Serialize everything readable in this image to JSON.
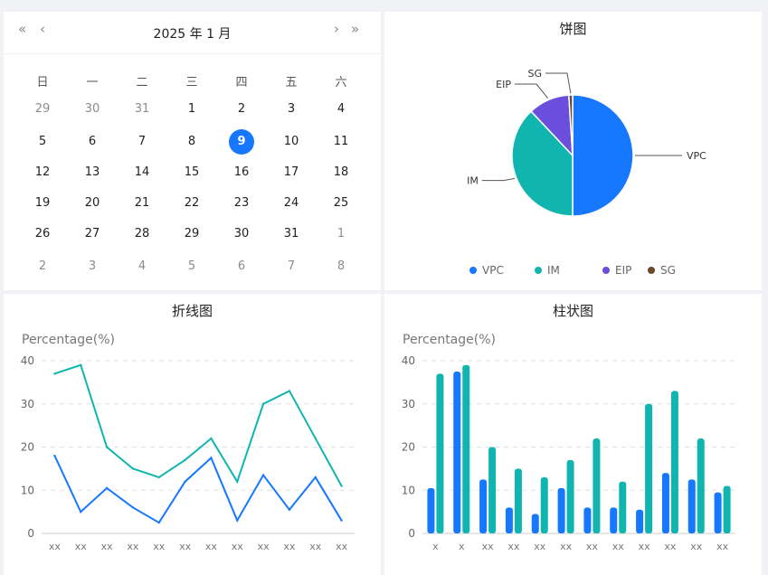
{
  "calendar": {
    "title": "2025 年  1 月",
    "nav": {
      "prev_year": "«",
      "prev_month": "‹",
      "next_month": "›",
      "next_year": "»"
    },
    "weekdays": [
      "日",
      "一",
      "二",
      "三",
      "四",
      "五",
      "六"
    ],
    "weeks": [
      [
        {
          "d": "29",
          "o": true
        },
        {
          "d": "30",
          "o": true
        },
        {
          "d": "31",
          "o": true
        },
        {
          "d": "1"
        },
        {
          "d": "2"
        },
        {
          "d": "3"
        },
        {
          "d": "4"
        }
      ],
      [
        {
          "d": "5"
        },
        {
          "d": "6"
        },
        {
          "d": "7"
        },
        {
          "d": "8"
        },
        {
          "d": "9",
          "sel": true
        },
        {
          "d": "10"
        },
        {
          "d": "11"
        }
      ],
      [
        {
          "d": "12"
        },
        {
          "d": "13"
        },
        {
          "d": "14"
        },
        {
          "d": "15"
        },
        {
          "d": "16"
        },
        {
          "d": "17"
        },
        {
          "d": "18"
        }
      ],
      [
        {
          "d": "19"
        },
        {
          "d": "20"
        },
        {
          "d": "21"
        },
        {
          "d": "22"
        },
        {
          "d": "23"
        },
        {
          "d": "24"
        },
        {
          "d": "25"
        }
      ],
      [
        {
          "d": "26"
        },
        {
          "d": "27"
        },
        {
          "d": "28"
        },
        {
          "d": "29"
        },
        {
          "d": "30"
        },
        {
          "d": "31"
        },
        {
          "d": "1",
          "o": true
        }
      ],
      [
        {
          "d": "2",
          "o": true
        },
        {
          "d": "3",
          "o": true
        },
        {
          "d": "4",
          "o": true
        },
        {
          "d": "5",
          "o": true
        },
        {
          "d": "6",
          "o": true
        },
        {
          "d": "7",
          "o": true
        },
        {
          "d": "8",
          "o": true
        }
      ]
    ],
    "accent": "#1677ff"
  },
  "pie_panel": {
    "title": "饼图"
  },
  "line_panel": {
    "title": "折线图"
  },
  "bar_panel": {
    "title": "柱状图"
  },
  "chart_data": [
    {
      "type": "pie",
      "title": "饼图",
      "slices": [
        {
          "label": "VPC",
          "value": 50,
          "color": "#1677ff"
        },
        {
          "label": "IM",
          "value": 38,
          "color": "#0fb5ae"
        },
        {
          "label": "EIP",
          "value": 11,
          "color": "#6b4fdc"
        },
        {
          "label": "SG",
          "value": 1,
          "color": "#6b4a2a"
        }
      ],
      "legend": [
        "VPC",
        "IM",
        "EIP",
        "SG"
      ],
      "legend_position": "bottom"
    },
    {
      "type": "line",
      "title": "折线图",
      "ylabel": "Percentage(%)",
      "ylim": [
        0,
        40
      ],
      "yticks": [
        0,
        10,
        20,
        30,
        40
      ],
      "categories": [
        "xx",
        "xx",
        "xx",
        "xx",
        "xx",
        "xx",
        "xx",
        "xx",
        "xx",
        "xx",
        "xx",
        "xx"
      ],
      "series": [
        {
          "values": [
            18,
            5,
            10.5,
            6,
            2.5,
            12,
            17.5,
            3,
            13.5,
            5.5,
            13,
            3
          ],
          "color": "#1677ff"
        },
        {
          "values": [
            37,
            39,
            20,
            15,
            13,
            17,
            22,
            12,
            30,
            33,
            22,
            11
          ],
          "color": "#0fb5ae"
        }
      ],
      "grid": true
    },
    {
      "type": "bar",
      "title": "柱状图",
      "ylabel": "Percentage(%)",
      "ylim": [
        0,
        40
      ],
      "yticks": [
        0,
        10,
        20,
        30,
        40
      ],
      "categories": [
        "x",
        "x",
        "xx",
        "xx",
        "xx",
        "xx",
        "xx",
        "xx",
        "xx",
        "xx",
        "xx",
        "xx"
      ],
      "series": [
        {
          "values": [
            10.5,
            37.5,
            12.5,
            6,
            4.5,
            10.5,
            6,
            6,
            5.5,
            14,
            12.5,
            9.5
          ],
          "color": "#1677ff"
        },
        {
          "values": [
            37,
            39,
            20,
            15,
            13,
            17,
            22,
            12,
            30,
            33,
            22,
            11
          ],
          "color": "#0fb5ae"
        }
      ],
      "grid": true
    }
  ]
}
